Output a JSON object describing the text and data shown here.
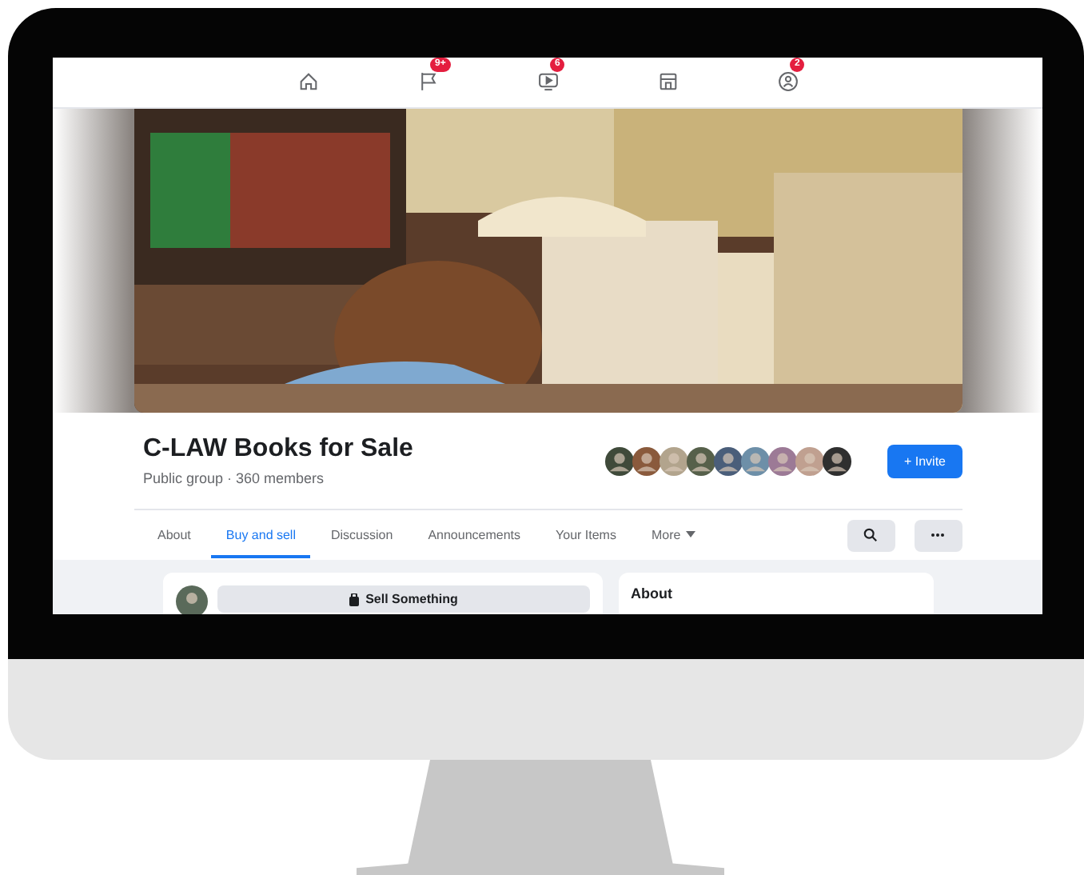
{
  "nav": {
    "items": [
      {
        "kind": "home",
        "selected": false
      },
      {
        "kind": "flag",
        "selected": false,
        "badge": "9+"
      },
      {
        "kind": "video",
        "selected": false,
        "badge": "6"
      },
      {
        "kind": "store",
        "selected": false
      },
      {
        "kind": "groups",
        "selected": false,
        "badge": "2"
      }
    ]
  },
  "group": {
    "name": "C-LAW Books for Sale",
    "privacy": "Public group · 360 members",
    "invite_button": "+ Invite"
  },
  "tabs": [
    {
      "label": "About",
      "selected": false
    },
    {
      "label": "Buy and sell",
      "selected": true
    },
    {
      "label": "Discussion",
      "selected": false
    },
    {
      "label": "Announcements",
      "selected": false
    },
    {
      "label": "Your Items",
      "selected": false
    },
    {
      "label": "More",
      "selected": false,
      "kind": "menu"
    }
  ],
  "composer": {
    "button": "Sell Something"
  },
  "about_card": {
    "title": "About"
  }
}
